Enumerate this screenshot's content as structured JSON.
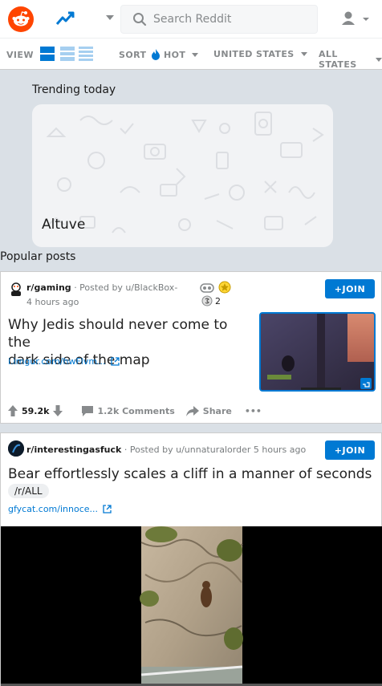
{
  "header": {
    "search_placeholder": "Search Reddit"
  },
  "viewbar": {
    "view_label": "VIEW",
    "sort_label": "SORT",
    "sort_value": "HOT",
    "region": "UNITED STATES",
    "state": "ALL STATES"
  },
  "trending": {
    "heading": "Trending today",
    "card_title": "Altuve"
  },
  "popular": {
    "heading": "Popular posts"
  },
  "posts": [
    {
      "subreddit": "r/gaming",
      "posted_by": "· Posted by u/BlackBox-",
      "time": "4 hours ago",
      "award_count": "2",
      "title_line1": "Why Jedis should never come to the",
      "title_line2": "dark side of the map",
      "link": "i.imgur.com/hwFlvm...",
      "join_label": "+JOIN",
      "votes": "59.2k",
      "comments": "1.2k Comments",
      "share": "Share",
      "more": "•••"
    },
    {
      "subreddit": "r/interestingasfuck",
      "posted_by": "· Posted by u/unnaturalorder 5 hours ago",
      "title": "Bear effortlessly scales a cliff in a manner of seconds",
      "tag": "/r/ALL",
      "link": "gfycat.com/innoce...",
      "join_label": "+JOIN"
    }
  ],
  "colors": {
    "brand": "#ff4500",
    "accent": "#0079d3",
    "page_bg": "#dae0e6"
  }
}
